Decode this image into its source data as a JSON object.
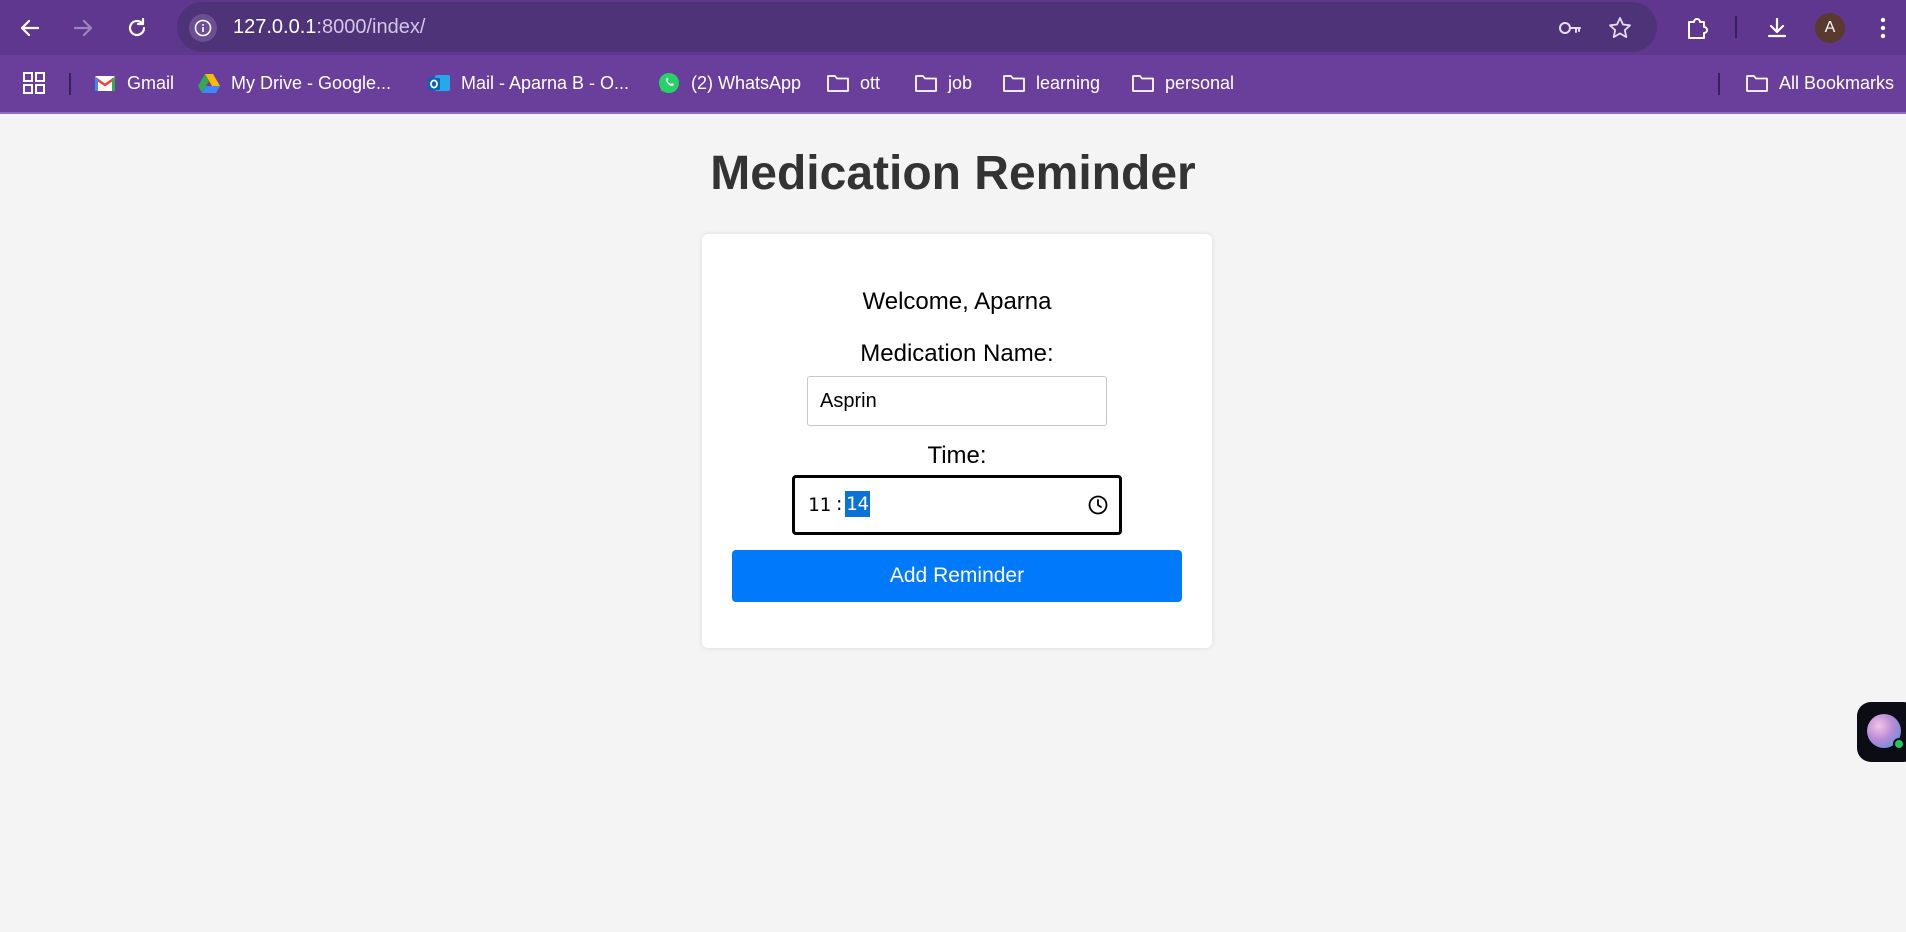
{
  "browser": {
    "url_host": "127.0.0.1",
    "url_path": ":8000/index/",
    "profile_initial": "A",
    "bookmarks": [
      {
        "label": "Gmail",
        "icon": "gmail-icon"
      },
      {
        "label": "My Drive - Google...",
        "icon": "google-drive-icon"
      },
      {
        "label": "Mail - Aparna B - O...",
        "icon": "outlook-icon"
      },
      {
        "label": "(2) WhatsApp",
        "icon": "whatsapp-icon"
      },
      {
        "label": "ott",
        "icon": "folder-icon"
      },
      {
        "label": "job",
        "icon": "folder-icon"
      },
      {
        "label": "learning",
        "icon": "folder-icon"
      },
      {
        "label": "personal",
        "icon": "folder-icon"
      }
    ],
    "all_bookmarks_label": "All Bookmarks",
    "colors": {
      "titlebar": "#60378f",
      "bookmark_bar": "#6a3f9c",
      "omnibox": "#4f3378"
    }
  },
  "page": {
    "title": "Medication Reminder",
    "welcome": "Welcome, Aparna",
    "medication_label": "Medication Name:",
    "medication_value": "Asprin",
    "time_label": "Time:",
    "time_hours": "11",
    "time_separator": ":",
    "time_minutes": "14",
    "submit_label": "Add Reminder",
    "colors": {
      "button": "#0079fb",
      "selection": "#0a72d6",
      "title": "#333333",
      "background": "#f4f4f4"
    }
  }
}
